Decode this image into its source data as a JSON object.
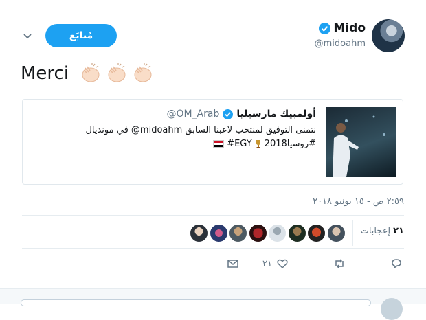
{
  "header": {
    "display_name": "Mido",
    "handle": "@midoahm",
    "follow_label": "مُتابَع"
  },
  "tweet": {
    "text": "Merci"
  },
  "quote": {
    "name": "أولمبيك مارسيليا",
    "handle": "@OM_Arab",
    "line1": "نتمنى التوفيق لمنتخب لاعبنا السابق midoahm@ في مونديال",
    "line2_hashtag1": "#روسيا2018",
    "line2_hashtag2": "#EGY"
  },
  "timestamp": "٢:٥٩ ص - ١٥ يونيو ٢٠١٨",
  "likes": {
    "count": "٢١",
    "label": "إعجابات"
  },
  "actions": {
    "like_count": "٢١"
  },
  "colors": {
    "accent": "#1da1f2",
    "muted": "#657786",
    "border": "#e6ecf0"
  },
  "icons": [
    "reply-icon",
    "retweet-icon",
    "heart-icon",
    "mail-icon",
    "chevron-down-icon",
    "verified-badge-icon",
    "clapping-hands-emoji",
    "trophy-emoji",
    "egypt-flag-emoji"
  ]
}
